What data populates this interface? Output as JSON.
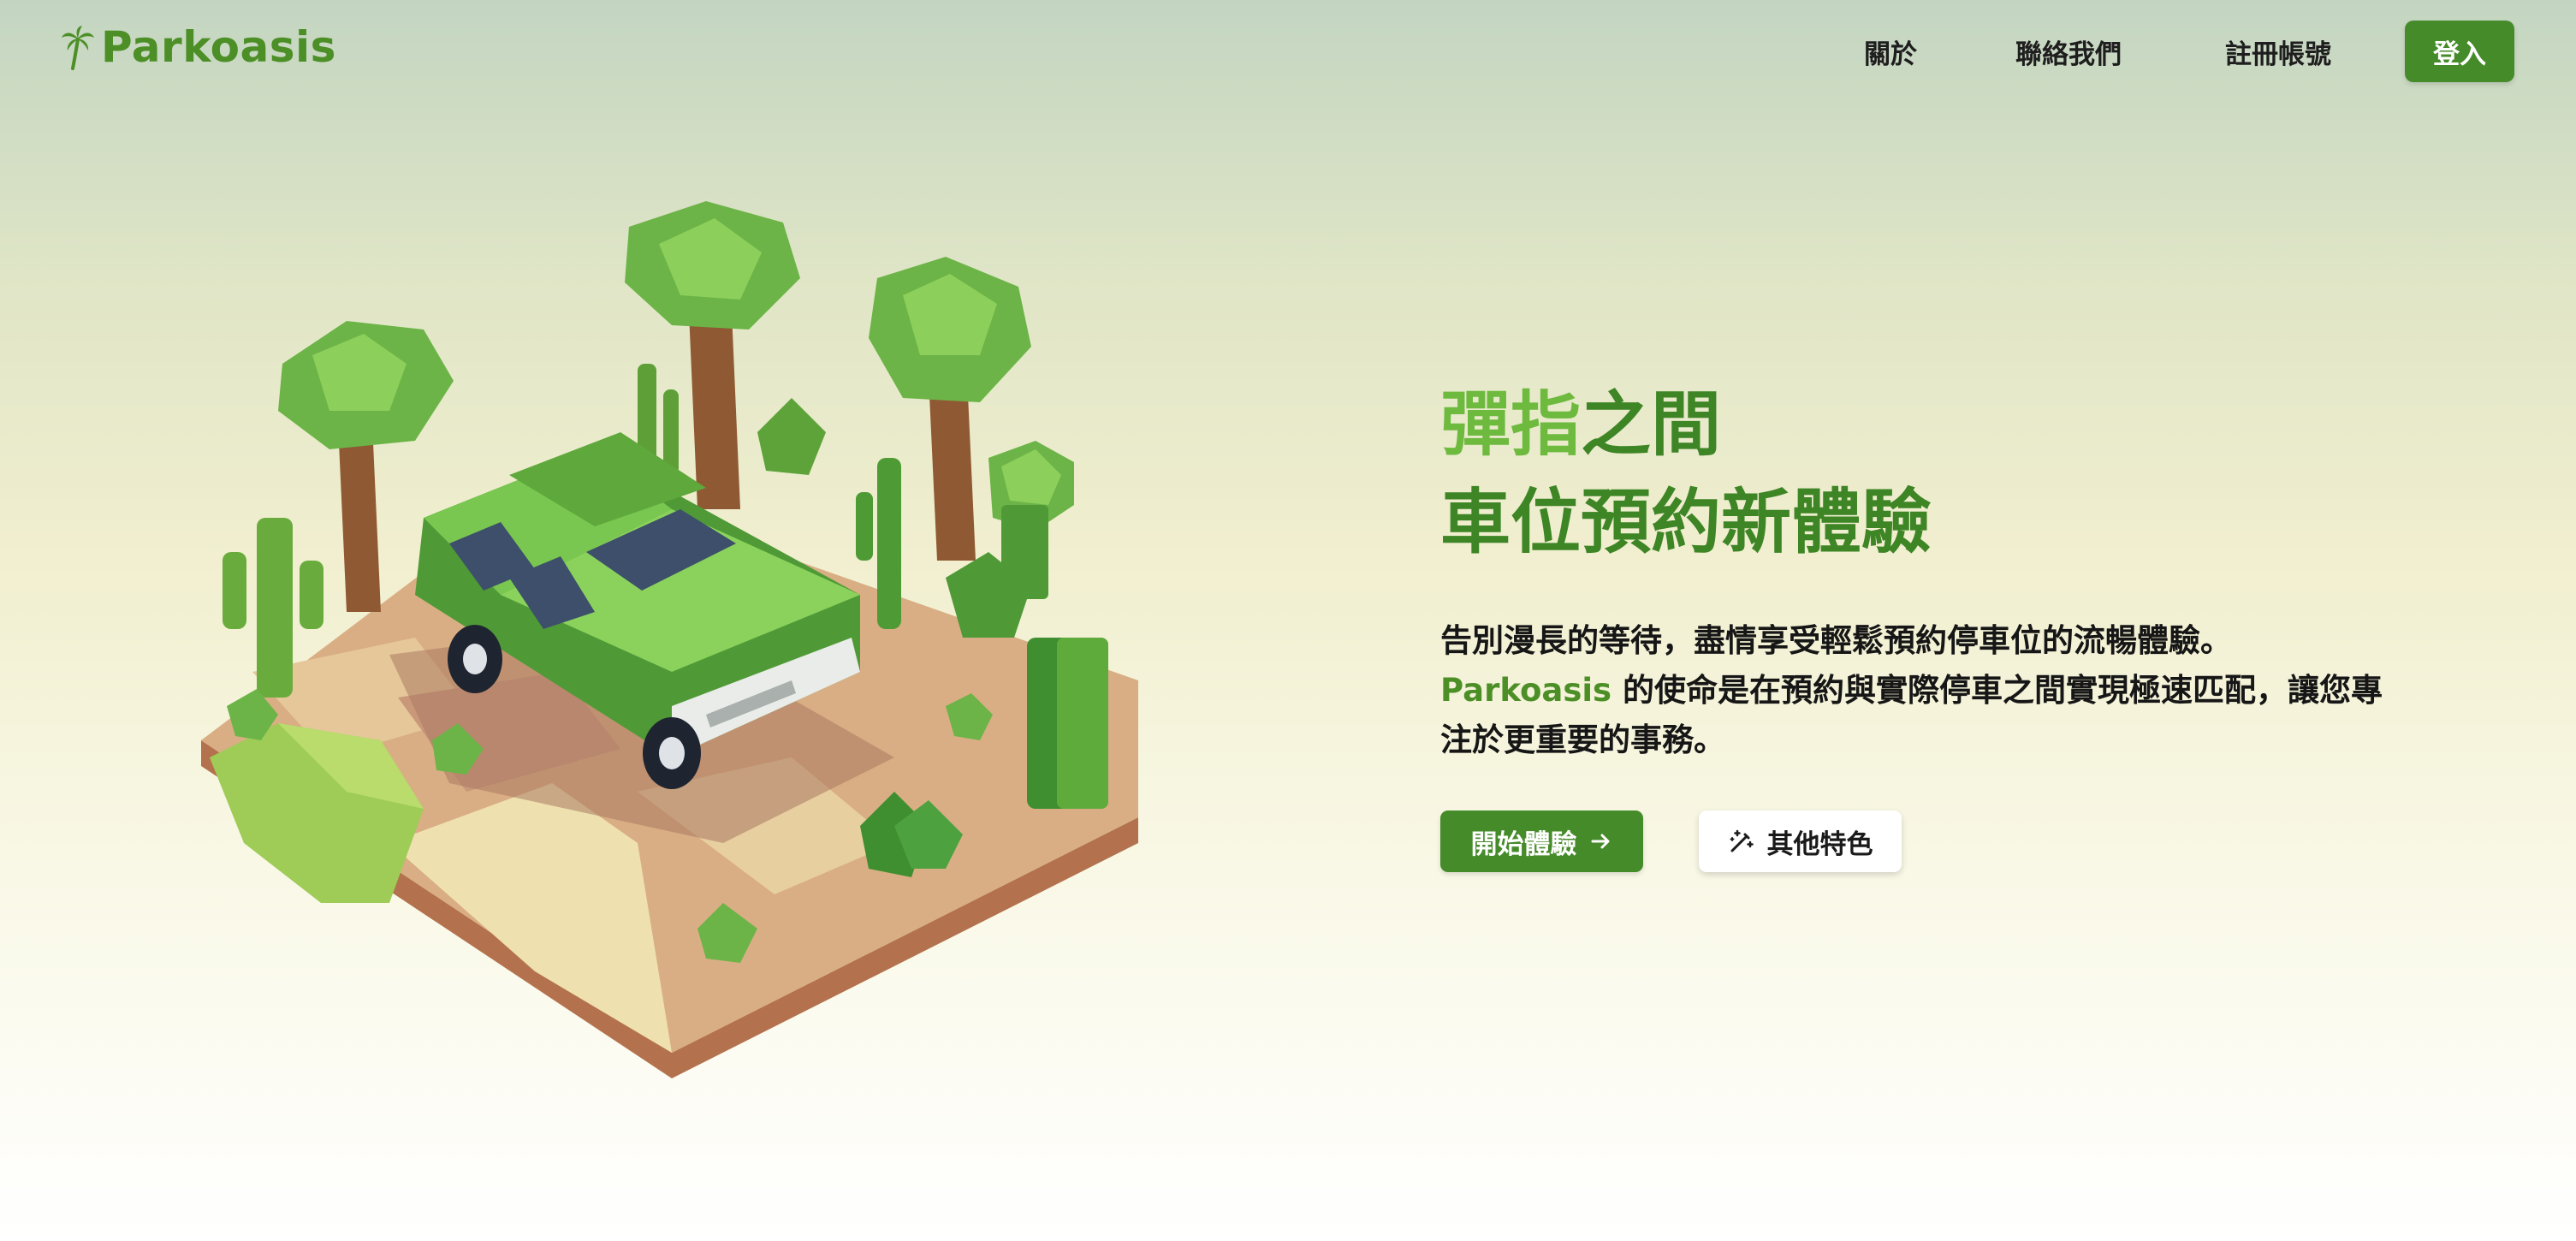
{
  "nav": {
    "brand": "Parkoasis",
    "brand_icon": "palm-tree-icon",
    "links": [
      {
        "label": "關於"
      },
      {
        "label": "聯絡我們"
      },
      {
        "label": "註冊帳號"
      }
    ],
    "login_label": "登入"
  },
  "hero": {
    "illustration": "low-poly-car-oasis-illustration",
    "headline_accent": "彈指",
    "headline_rest": "之間",
    "headline_line2": "車位預約新體驗",
    "desc_line1": "告別漫長的等待，盡情享受輕鬆預約停車位的流暢體驗。",
    "desc_brand": "Parkoasis",
    "desc_line2": " 的使命是在預約與實際停車之間實現極速匹配，讓您專注於更重要的事務。",
    "cta_primary": "開始體驗",
    "cta_primary_icon": "arrow-right-icon",
    "cta_secondary": "其他特色",
    "cta_secondary_icon": "magic-wand-icon"
  },
  "colors": {
    "brand_green": "#4c8f26",
    "accent_green": "#6dba3f",
    "button_green": "#458b2a"
  }
}
